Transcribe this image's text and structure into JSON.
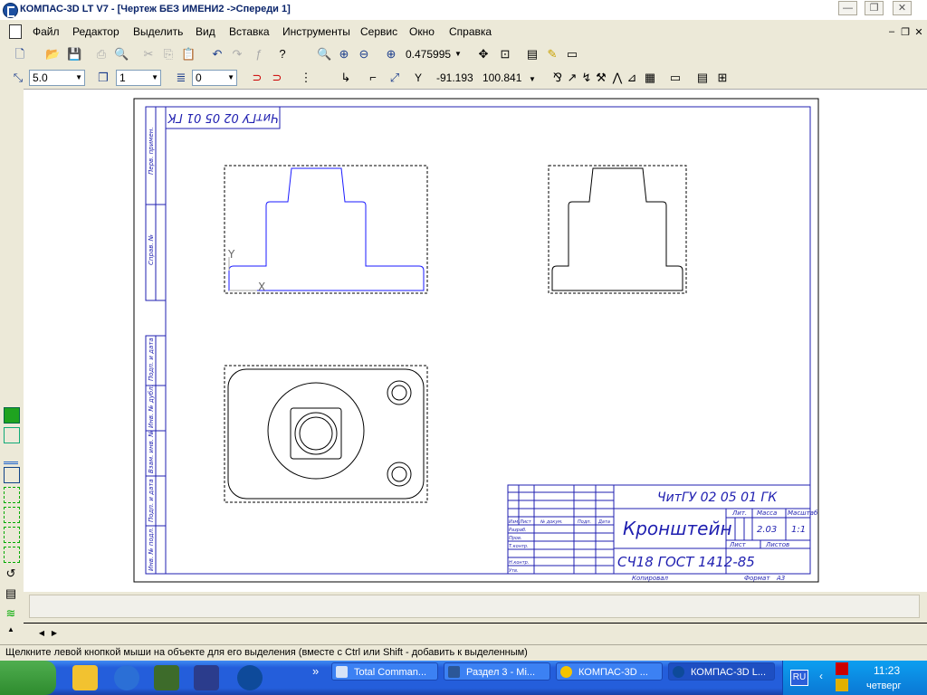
{
  "window": {
    "title": "КОМПАС-3D LT V7 - [Чертеж БЕЗ ИМЕНИ2 ->Спереди 1]",
    "minimize": "—",
    "maximize": "❐",
    "close": "✕"
  },
  "menu": [
    "Файл",
    "Редактор",
    "Выделить",
    "Вид",
    "Вставка",
    "Инструменты",
    "Сервис",
    "Окно",
    "Справка"
  ],
  "toolbar1": {
    "zoom_value": "0.475995"
  },
  "toolbar2": {
    "step": "5.0",
    "layer": "1",
    "style": "0",
    "coord_x": "-91.193",
    "coord_y": "100.841",
    "coord_label": "Y"
  },
  "drawing": {
    "rot_stamp": "ЧитГУ 02 05 01 ГК",
    "side_labels": [
      "Перв. примен.",
      "Справ. №",
      "Подп. и дата",
      "Инв. № дубл.",
      "Взам. инв. №",
      "Подп. и дата",
      "Инв. № подл."
    ],
    "axis_y": "Y",
    "axis_x": "X",
    "stamp": {
      "designation": "ЧитГУ 02 05 01 ГК",
      "name": "Кронштейн",
      "material": "СЧ18 ГОСТ 1412-85",
      "lit_label": "Лит.",
      "mass_label": "Масса",
      "scale_label": "Масштаб",
      "mass": "2.03",
      "scale": "1:1",
      "sheet_label": "Лист",
      "sheets_label": "Листов",
      "copied_label": "Копировал",
      "format_label": "Формат",
      "format": "А3",
      "col_headers": [
        "Изм.",
        "Лист",
        "№ докум.",
        "Подп.",
        "Дата"
      ],
      "row_labels": [
        "Разраб.",
        "Пров.",
        "Т.контр.",
        "",
        "Н.контр.",
        "Утв."
      ]
    }
  },
  "status_text": "Щелкните левой кнопкой мыши на объекте для его выделения (вместе с Ctrl или Shift - добавить к выделенным)",
  "taskbar": {
    "items": [
      "Total Comman...",
      "Раздел 3 - Mi...",
      "КОМПАС-3D ...",
      "КОМПАС-3D L..."
    ],
    "lang": "RU",
    "time": "11:23",
    "day": "четверг",
    "expand": "»"
  },
  "colors": {
    "drawing_line": "#1f1fb0",
    "selected_line": "#1a1aff",
    "title_text": "#0a246a"
  }
}
